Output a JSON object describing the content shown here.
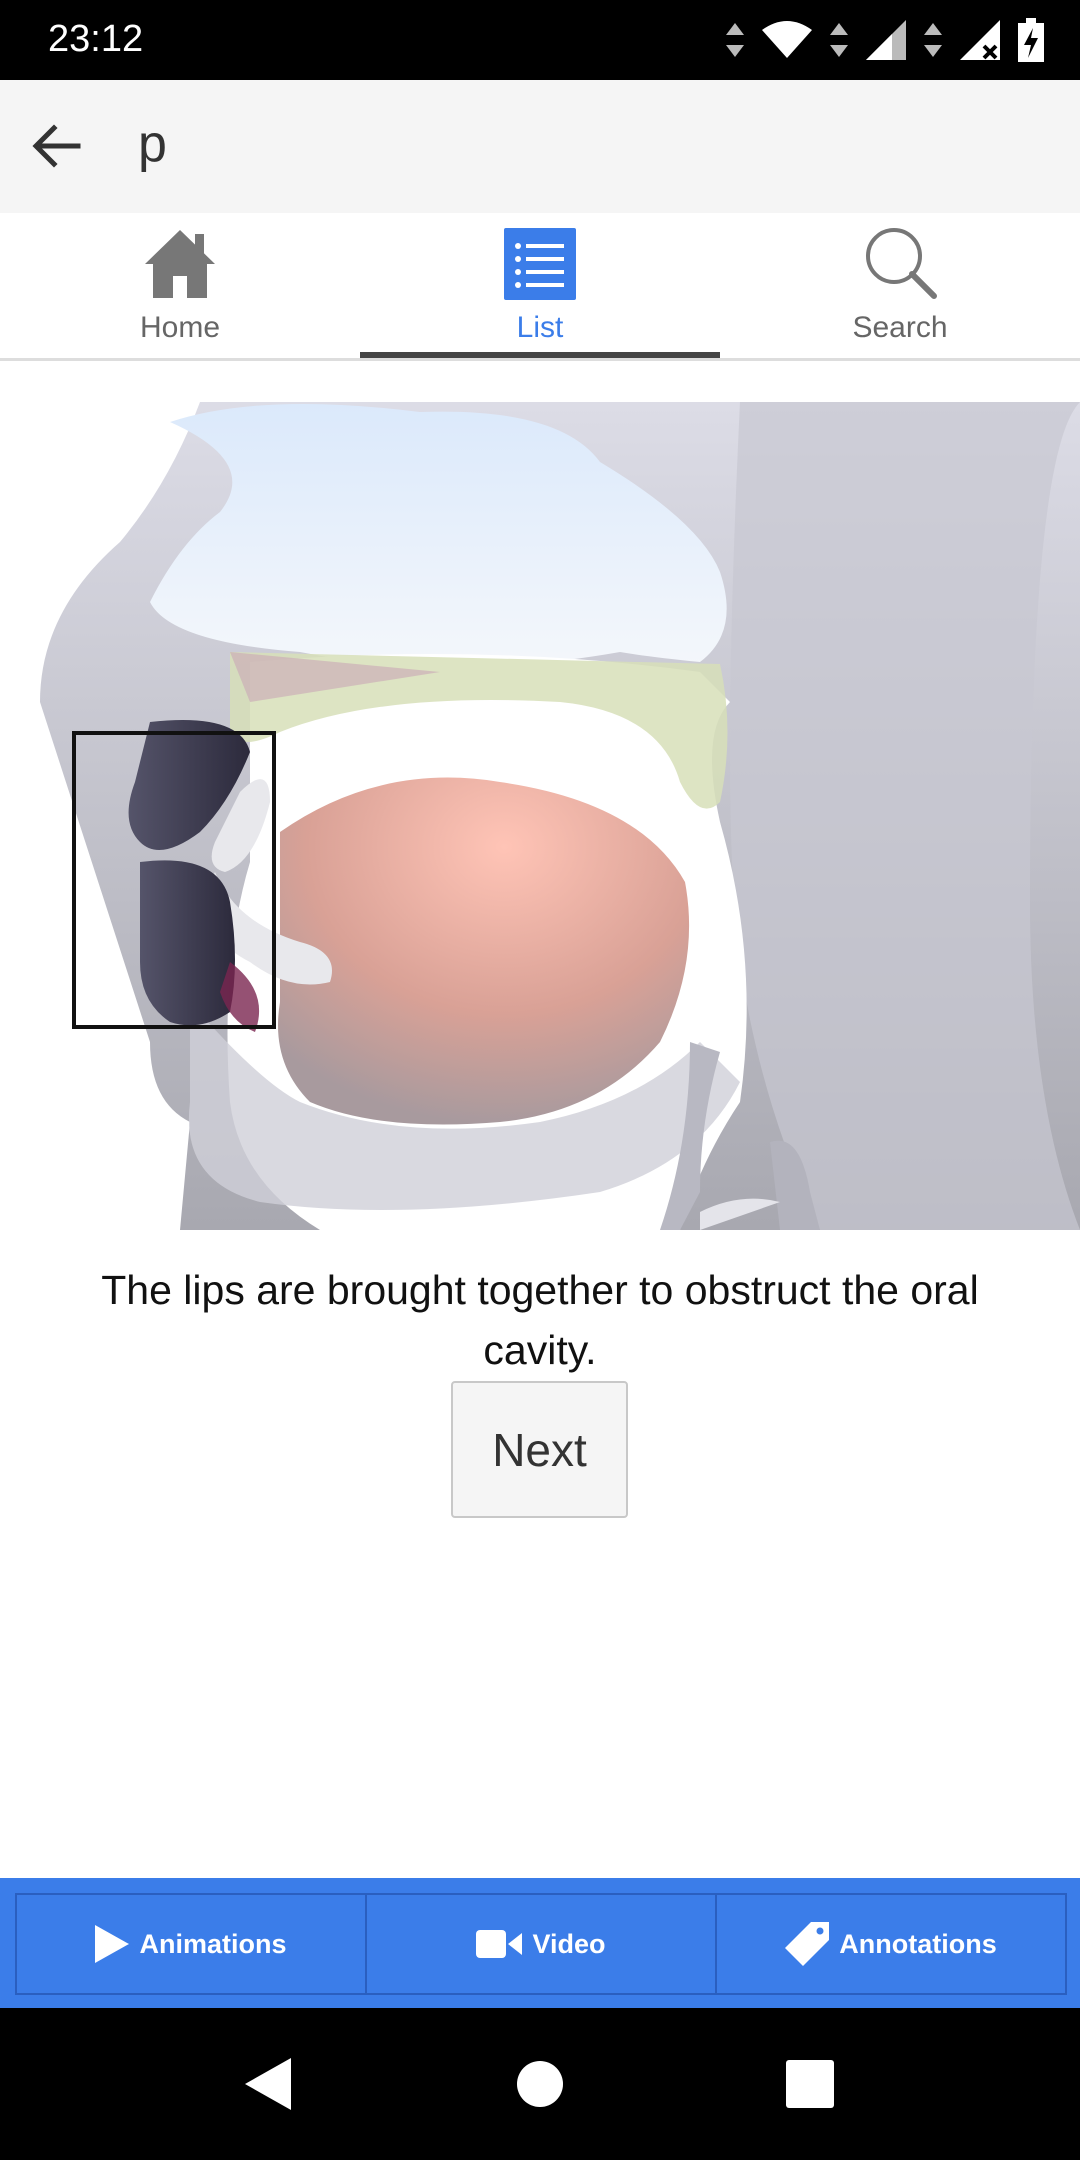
{
  "status_bar": {
    "time": "23:12"
  },
  "app_bar": {
    "title": "p"
  },
  "tabs": [
    {
      "label": "Home",
      "icon": "home-icon",
      "active": false
    },
    {
      "label": "List",
      "icon": "list-icon",
      "active": true
    },
    {
      "label": "Search",
      "icon": "search-icon",
      "active": false
    }
  ],
  "content": {
    "caption": "The lips are brought together to obstruct the oral cavity.",
    "next_label": "Next"
  },
  "bottom_tabs": [
    {
      "label": "Animations",
      "icon": "play-icon"
    },
    {
      "label": "Video",
      "icon": "video-camera-icon"
    },
    {
      "label": "Annotations",
      "icon": "tag-icon"
    }
  ],
  "colors": {
    "accent": "#3b7de9",
    "tab_active": "#3b7de9",
    "tab_inactive": "#666666"
  }
}
